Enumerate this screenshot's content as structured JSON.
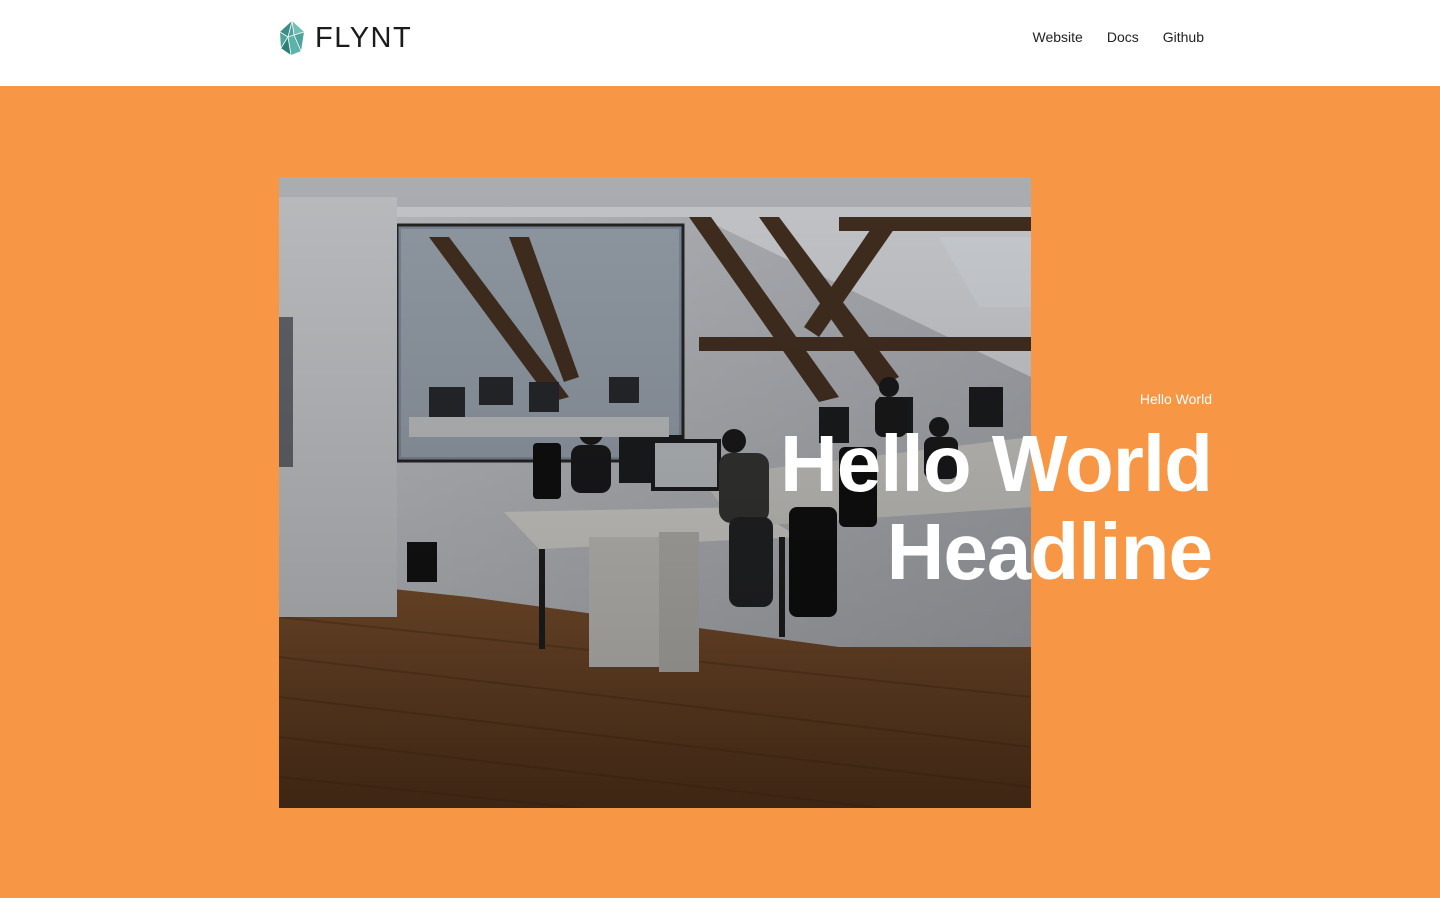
{
  "header": {
    "logo_text": "FLYNT",
    "logo_icon": "flynt-gem-icon",
    "nav": [
      {
        "label": "Website"
      },
      {
        "label": "Docs"
      },
      {
        "label": "Github"
      }
    ]
  },
  "hero": {
    "pretitle": "Hello World",
    "headline_line1": "Hello World",
    "headline_line2": "Headline",
    "image_subject": "office-photo",
    "background_color": "#f79745"
  },
  "colors": {
    "accent": "#f79745",
    "logo_teal": "#4fa39c",
    "text_dark": "#1b1b1b"
  }
}
